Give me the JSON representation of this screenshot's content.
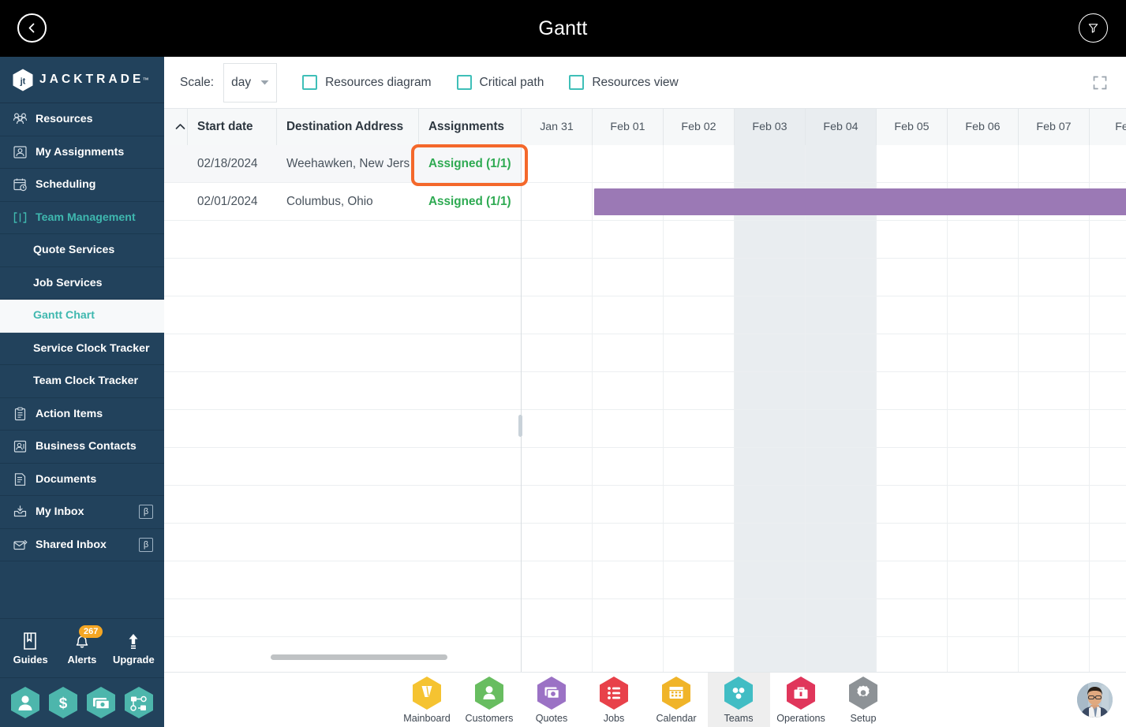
{
  "topbar": {
    "title": "Gantt",
    "back_icon": "chevron-left-icon",
    "filter_icon": "funnel-filter-icon"
  },
  "sidebar": {
    "brand": {
      "name": "JACKTRADE",
      "tm": "™"
    },
    "items": [
      {
        "label": "Resources",
        "icon": "resources-group-icon",
        "kind": "top",
        "state": "normal"
      },
      {
        "label": "My Assignments",
        "icon": "assignments-icon",
        "kind": "top",
        "state": "normal"
      },
      {
        "label": "Scheduling",
        "icon": "calendar-clock-icon",
        "kind": "top",
        "state": "normal"
      },
      {
        "label": "Team Management",
        "icon": "team-brackets-icon",
        "kind": "top",
        "state": "expanded"
      },
      {
        "label": "Quote Services",
        "icon": "",
        "kind": "sub",
        "state": "normal"
      },
      {
        "label": "Job Services",
        "icon": "",
        "kind": "sub",
        "state": "normal"
      },
      {
        "label": "Gantt Chart",
        "icon": "",
        "kind": "sub",
        "state": "current"
      },
      {
        "label": "Service Clock Tracker",
        "icon": "",
        "kind": "sub",
        "state": "normal"
      },
      {
        "label": "Team Clock Tracker",
        "icon": "",
        "kind": "sub",
        "state": "normal"
      },
      {
        "label": "Action Items",
        "icon": "clipboard-list-icon",
        "kind": "top",
        "state": "normal"
      },
      {
        "label": "Business Contacts",
        "icon": "contact-card-icon",
        "kind": "top",
        "state": "normal"
      },
      {
        "label": "Documents",
        "icon": "document-icon",
        "kind": "top",
        "state": "normal"
      },
      {
        "label": "My Inbox",
        "icon": "inbox-download-icon",
        "kind": "top",
        "state": "normal",
        "badge": "β"
      },
      {
        "label": "Shared Inbox",
        "icon": "envelope-share-icon",
        "kind": "top",
        "state": "normal",
        "badge": "β"
      }
    ],
    "tools": [
      {
        "label": "Guides",
        "icon": "book-icon"
      },
      {
        "label": "Alerts",
        "icon": "bell-icon",
        "badge": "267"
      },
      {
        "label": "Upgrade",
        "icon": "arrow-up-icon"
      }
    ],
    "hex_shortcuts": [
      {
        "icon": "user-hex-icon"
      },
      {
        "icon": "dollar-hex-icon"
      },
      {
        "icon": "payment-hex-icon"
      },
      {
        "icon": "workflow-hex-icon"
      }
    ],
    "colors": {
      "bg": "#22425c",
      "accent": "#3fb8af",
      "badge": "#f5a623",
      "hex": "#4db6ac"
    }
  },
  "toolbar": {
    "scale_label": "Scale:",
    "scale_value": "day",
    "scale_options": [
      "day"
    ],
    "checkboxes": [
      {
        "label": "Resources diagram",
        "checked": false
      },
      {
        "label": "Critical path",
        "checked": false
      },
      {
        "label": "Resources view",
        "checked": false
      }
    ],
    "fullscreen_icon": "fullscreen-expand-icon"
  },
  "grid": {
    "sort_icon": "chevron-up-icon",
    "columns": [
      "Start date",
      "Destination Address",
      "Assignments"
    ],
    "rows": [
      {
        "start_date": "02/18/2024",
        "address": "Weehawken, New Jers",
        "assignments": "Assigned (1/1)",
        "highlighted": true
      },
      {
        "start_date": "02/01/2024",
        "address": "Columbus, Ohio",
        "assignments": "Assigned (1/1)",
        "highlighted": false
      }
    ],
    "empty_rows": 12,
    "highlight_color": "#f4682b",
    "assignment_color": "#2eaa52"
  },
  "timeline": {
    "columns": [
      {
        "label": "Jan 31",
        "weekend": false
      },
      {
        "label": "Feb 01",
        "weekend": false
      },
      {
        "label": "Feb 02",
        "weekend": false
      },
      {
        "label": "Feb 03",
        "weekend": true
      },
      {
        "label": "Feb 04",
        "weekend": true
      },
      {
        "label": "Feb 05",
        "weekend": false
      },
      {
        "label": "Feb 06",
        "weekend": false
      },
      {
        "label": "Feb 07",
        "weekend": false
      },
      {
        "label": "Feb",
        "weekend": false
      }
    ],
    "bars": [
      {
        "row": 1,
        "start_col": 1,
        "span_cols": 8.5,
        "color": "#9b79b5",
        "label": ""
      }
    ]
  },
  "bottomnav": {
    "items": [
      {
        "label": "Mainboard",
        "icon": "mainboard-hex-icon",
        "color": "#f5c331",
        "active": false
      },
      {
        "label": "Customers",
        "icon": "customers-hex-icon",
        "color": "#68bd60",
        "active": false
      },
      {
        "label": "Quotes",
        "icon": "quotes-hex-icon",
        "color": "#9b72c5",
        "active": false
      },
      {
        "label": "Jobs",
        "icon": "jobs-hex-icon",
        "color": "#e8414a",
        "active": false
      },
      {
        "label": "Calendar",
        "icon": "calendar-hex-icon",
        "color": "#f0b429",
        "active": false
      },
      {
        "label": "Teams",
        "icon": "teams-hex-icon",
        "color": "#41bdc4",
        "active": true
      },
      {
        "label": "Operations",
        "icon": "operations-hex-icon",
        "color": "#e0365b",
        "active": false
      },
      {
        "label": "Setup",
        "icon": "setup-hex-icon",
        "color": "#8d9296",
        "active": false
      }
    ],
    "avatar": "user-avatar"
  }
}
